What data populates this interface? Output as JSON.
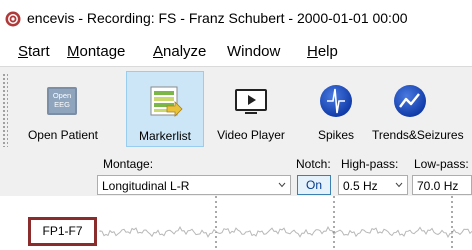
{
  "window": {
    "title": "encevis - Recording: FS - Franz Schubert - 2000-01-01 00:00"
  },
  "menu": [
    {
      "prefix": "",
      "mnemonic": "S",
      "rest": "tart"
    },
    {
      "prefix": "",
      "mnemonic": "M",
      "rest": "ontage"
    },
    {
      "prefix": "",
      "mnemonic": "A",
      "rest": "nalyze"
    },
    {
      "prefix": "Wi",
      "mnemonic": "",
      "rest": "ndow"
    },
    {
      "prefix": "",
      "mnemonic": "H",
      "rest": "elp"
    }
  ],
  "toolbar": {
    "open_patient": {
      "label": "Open Patient",
      "icon_text1": "Open",
      "icon_text2": "EEG",
      "icon": "folder-eeg-icon"
    },
    "markerlist": {
      "label": "Markerlist",
      "icon": "list-arrow-icon",
      "active": true
    },
    "video_player": {
      "label": "Video Player",
      "icon": "video-player-icon"
    },
    "spikes": {
      "label": "Spikes",
      "icon": "spike-icon"
    },
    "trends": {
      "label": "Trends&Seizures",
      "icon": "trend-icon"
    }
  },
  "controls": {
    "montage_label": "Montage:",
    "montage_value": "Longitudinal L-R",
    "notch_label": "Notch:",
    "notch_button": "On",
    "highpass_label": "High-pass:",
    "highpass_value": "0.5 Hz",
    "lowpass_label": "Low-pass:",
    "lowpass_value": "70.0 Hz"
  },
  "signal": {
    "channel_label": "FP1-F7"
  },
  "colors": {
    "active_button_bg": "#cde6f7",
    "channel_box_border": "#8b2c2c",
    "trace": "#b8b8b8"
  }
}
